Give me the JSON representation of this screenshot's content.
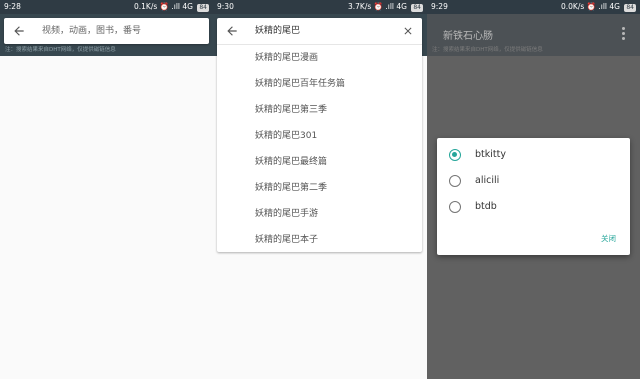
{
  "panels": [
    {
      "status": {
        "time": "9:28",
        "right": "0.1K/s ⏰ .ıll 4G",
        "battery": "84"
      },
      "search": {
        "placeholder": "视频，动画，图书，番号"
      },
      "hint": "注：搜索结果来自DHT网络，仅提供磁链信息"
    },
    {
      "status": {
        "time": "9:30",
        "right": "3.7K/s ⏰ .ıll 4G",
        "battery": "84"
      },
      "search": {
        "value": "妖精的尾巴"
      },
      "suggestions": [
        "妖精的尾巴漫画",
        "妖精的尾巴百年任务篇",
        "妖精的尾巴第三季",
        "妖精的尾巴301",
        "妖精的尾巴最终篇",
        "妖精的尾巴第二季",
        "妖精的尾巴手游",
        "妖精的尾巴本子"
      ]
    },
    {
      "status": {
        "time": "9:29",
        "right": "0.0K/s ⏰ .ıll 4G",
        "battery": "84"
      },
      "app_bar": {
        "title": "新铁石心肠"
      },
      "hint": "注：搜索结果来自DHT网络，仅提供磁链信息",
      "dialog": {
        "options": [
          {
            "label": "btkitty",
            "selected": true
          },
          {
            "label": "alicili",
            "selected": false
          },
          {
            "label": "btdb",
            "selected": false
          }
        ],
        "close_label": "关闭"
      }
    }
  ],
  "colors": {
    "accent": "#26a69a",
    "statusbar": "#2f3b44",
    "header": "#37474f",
    "scrim": "#616161"
  }
}
